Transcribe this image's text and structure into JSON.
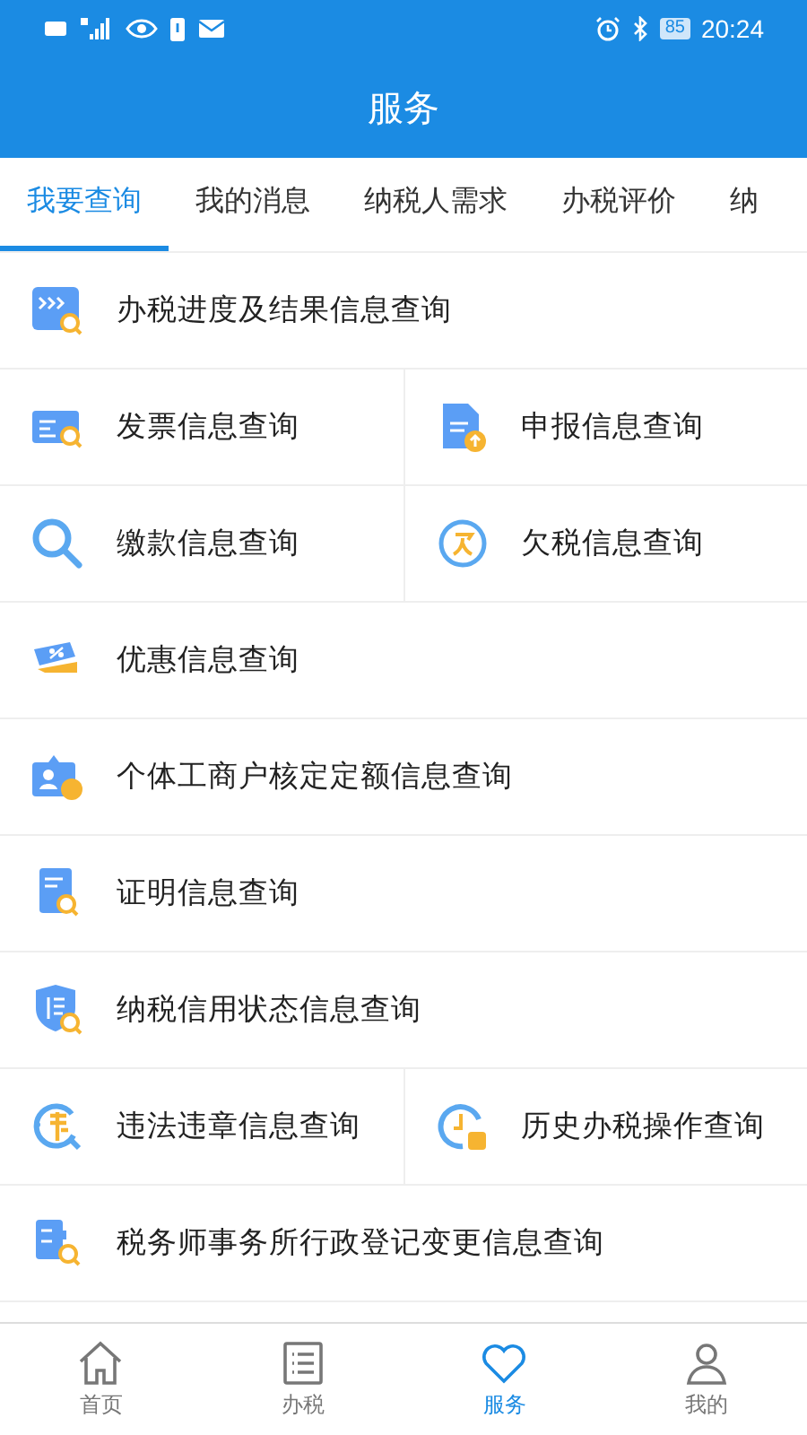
{
  "status_bar": {
    "battery": "85",
    "time": "20:24"
  },
  "header": {
    "title": "服务"
  },
  "tabs": [
    {
      "label": "我要查询",
      "selected": true
    },
    {
      "label": "我的消息",
      "selected": false
    },
    {
      "label": "纳税人需求",
      "selected": false
    },
    {
      "label": "办税评价",
      "selected": false
    },
    {
      "label": "纳",
      "selected": false
    }
  ],
  "rows": [
    {
      "items": [
        {
          "label": "办税进度及结果信息查询"
        }
      ]
    },
    {
      "items": [
        {
          "label": "发票信息查询"
        },
        {
          "label": "申报信息查询"
        }
      ]
    },
    {
      "items": [
        {
          "label": "缴款信息查询"
        },
        {
          "label": "欠税信息查询"
        }
      ]
    },
    {
      "items": [
        {
          "label": "优惠信息查询"
        }
      ]
    },
    {
      "items": [
        {
          "label": "个体工商户核定定额信息查询"
        }
      ]
    },
    {
      "items": [
        {
          "label": "证明信息查询"
        }
      ]
    },
    {
      "items": [
        {
          "label": "纳税信用状态信息查询"
        }
      ]
    },
    {
      "items": [
        {
          "label": "违法违章信息查询"
        },
        {
          "label": "历史办税操作查询"
        }
      ]
    },
    {
      "items": [
        {
          "label": "税务师事务所行政登记变更信息查询"
        }
      ]
    }
  ],
  "nav": [
    {
      "label": "首页",
      "selected": false
    },
    {
      "label": "办税",
      "selected": false
    },
    {
      "label": "服务",
      "selected": true
    },
    {
      "label": "我的",
      "selected": false
    }
  ]
}
